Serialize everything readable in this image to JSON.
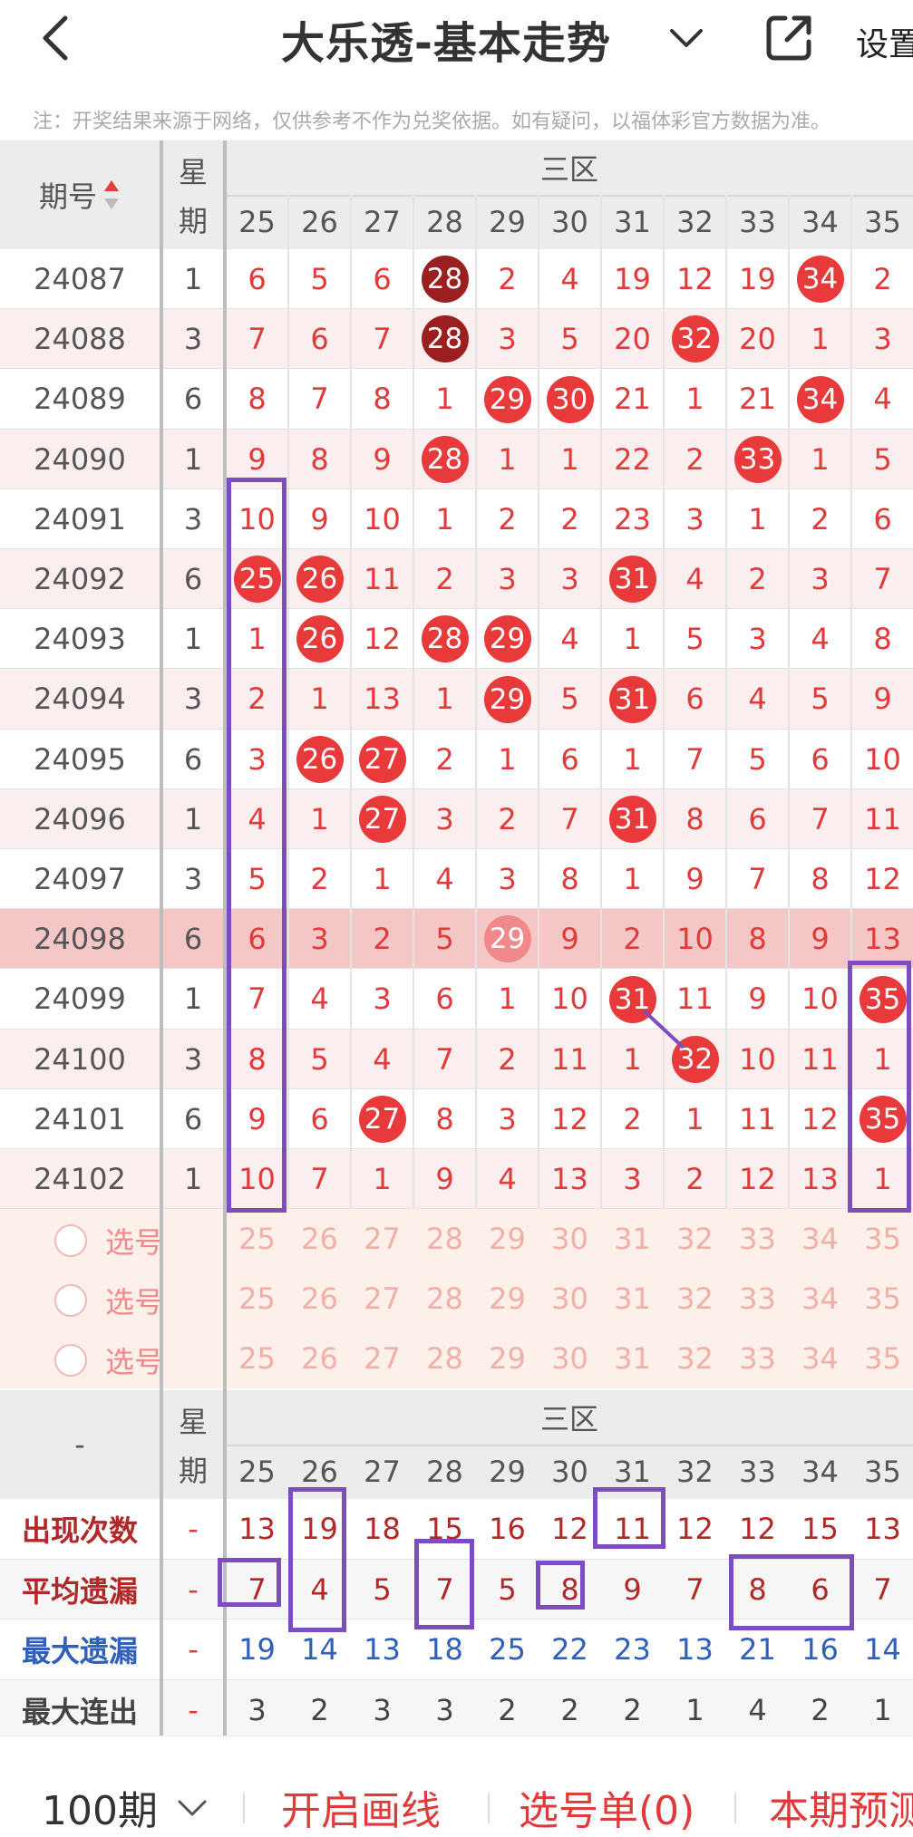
{
  "header": {
    "title": "大乐透-基本走势",
    "settings_label": "设置",
    "note": "注：开奖结果来源于网络，仅供参考不作为兑奖依据。如有疑问，以福体彩官方数据为准。"
  },
  "grid": {
    "issue_header": "期号",
    "week_header_1": "星",
    "week_header_2": "期",
    "zone_header": "三区",
    "columns": [
      "25",
      "26",
      "27",
      "28",
      "29",
      "30",
      "31",
      "32",
      "33",
      "34",
      "35"
    ],
    "rows": [
      {
        "issue": "24087",
        "week": "1",
        "cells": [
          "6",
          "5",
          "6",
          "28",
          "2",
          "4",
          "19",
          "12",
          "19",
          "34",
          "2"
        ],
        "hits": [
          3,
          9
        ],
        "dark": [
          3
        ]
      },
      {
        "issue": "24088",
        "week": "3",
        "cells": [
          "7",
          "6",
          "7",
          "28",
          "3",
          "5",
          "20",
          "32",
          "20",
          "1",
          "3"
        ],
        "hits": [
          3,
          7
        ],
        "dark": [
          3
        ]
      },
      {
        "issue": "24089",
        "week": "6",
        "cells": [
          "8",
          "7",
          "8",
          "1",
          "29",
          "30",
          "21",
          "1",
          "21",
          "34",
          "4"
        ],
        "hits": [
          4,
          5,
          9
        ],
        "dark": []
      },
      {
        "issue": "24090",
        "week": "1",
        "cells": [
          "9",
          "8",
          "9",
          "28",
          "1",
          "1",
          "22",
          "2",
          "33",
          "1",
          "5"
        ],
        "hits": [
          3,
          8
        ],
        "dark": []
      },
      {
        "issue": "24091",
        "week": "3",
        "cells": [
          "10",
          "9",
          "10",
          "1",
          "2",
          "2",
          "23",
          "3",
          "1",
          "2",
          "6"
        ],
        "hits": [],
        "dark": []
      },
      {
        "issue": "24092",
        "week": "6",
        "cells": [
          "25",
          "26",
          "11",
          "2",
          "3",
          "3",
          "31",
          "4",
          "2",
          "3",
          "7"
        ],
        "hits": [
          0,
          1,
          6
        ],
        "dark": []
      },
      {
        "issue": "24093",
        "week": "1",
        "cells": [
          "1",
          "26",
          "12",
          "28",
          "29",
          "4",
          "1",
          "5",
          "3",
          "4",
          "8"
        ],
        "hits": [
          1,
          3,
          4
        ],
        "dark": []
      },
      {
        "issue": "24094",
        "week": "3",
        "cells": [
          "2",
          "1",
          "13",
          "1",
          "29",
          "5",
          "31",
          "6",
          "4",
          "5",
          "9"
        ],
        "hits": [
          4,
          6
        ],
        "dark": []
      },
      {
        "issue": "24095",
        "week": "6",
        "cells": [
          "3",
          "26",
          "27",
          "2",
          "1",
          "6",
          "1",
          "7",
          "5",
          "6",
          "10"
        ],
        "hits": [
          1,
          2
        ],
        "dark": []
      },
      {
        "issue": "24096",
        "week": "1",
        "cells": [
          "4",
          "1",
          "27",
          "3",
          "2",
          "7",
          "31",
          "8",
          "6",
          "7",
          "11"
        ],
        "hits": [
          2,
          6
        ],
        "dark": []
      },
      {
        "issue": "24097",
        "week": "3",
        "cells": [
          "5",
          "2",
          "1",
          "4",
          "3",
          "8",
          "1",
          "9",
          "7",
          "8",
          "12"
        ],
        "hits": [],
        "dark": []
      },
      {
        "issue": "24098",
        "week": "6",
        "cells": [
          "6",
          "3",
          "2",
          "5",
          "29",
          "9",
          "2",
          "10",
          "8",
          "9",
          "13"
        ],
        "hits": [
          4
        ],
        "dark": [],
        "highlight": true
      },
      {
        "issue": "24099",
        "week": "1",
        "cells": [
          "7",
          "4",
          "3",
          "6",
          "1",
          "10",
          "31",
          "11",
          "9",
          "10",
          "35"
        ],
        "hits": [
          6,
          10
        ],
        "dark": []
      },
      {
        "issue": "24100",
        "week": "3",
        "cells": [
          "8",
          "5",
          "4",
          "7",
          "2",
          "11",
          "1",
          "32",
          "10",
          "11",
          "1"
        ],
        "hits": [
          7
        ],
        "dark": []
      },
      {
        "issue": "24101",
        "week": "6",
        "cells": [
          "9",
          "6",
          "27",
          "8",
          "3",
          "12",
          "2",
          "1",
          "11",
          "12",
          "35"
        ],
        "hits": [
          2,
          10
        ],
        "dark": []
      },
      {
        "issue": "24102",
        "week": "1",
        "cells": [
          "10",
          "7",
          "1",
          "9",
          "4",
          "13",
          "3",
          "2",
          "12",
          "13",
          "1"
        ],
        "hits": [],
        "dark": []
      }
    ],
    "select_label": "选号",
    "stats": {
      "label_dash": "-",
      "rows": [
        {
          "label": "出现次数",
          "color": "#b02828",
          "week": "-",
          "values": [
            "13",
            "19",
            "18",
            "15",
            "16",
            "12",
            "11",
            "12",
            "12",
            "15",
            "13"
          ]
        },
        {
          "label": "平均遗漏",
          "color": "#b02828",
          "week": "-",
          "values": [
            "7",
            "4",
            "5",
            "7",
            "5",
            "8",
            "9",
            "7",
            "8",
            "6",
            "7"
          ]
        },
        {
          "label": "最大遗漏",
          "color": "#2f5fb8",
          "week": "-",
          "values": [
            "19",
            "14",
            "13",
            "18",
            "25",
            "22",
            "23",
            "13",
            "21",
            "16",
            "14"
          ]
        },
        {
          "label": "最大连出",
          "color": "#444444",
          "week": "-",
          "values": [
            "3",
            "2",
            "3",
            "3",
            "2",
            "2",
            "2",
            "1",
            "4",
            "2",
            "1"
          ]
        }
      ]
    }
  },
  "footer": {
    "period": "100期",
    "draw_line": "开启画线",
    "select_list": "选号单(0)",
    "forecast": "本期预测"
  },
  "colors": {
    "red": "#e83a3a",
    "dark_red": "#9b1f1f",
    "purple": "#7c4dbf",
    "blue": "#2f5fb8"
  }
}
